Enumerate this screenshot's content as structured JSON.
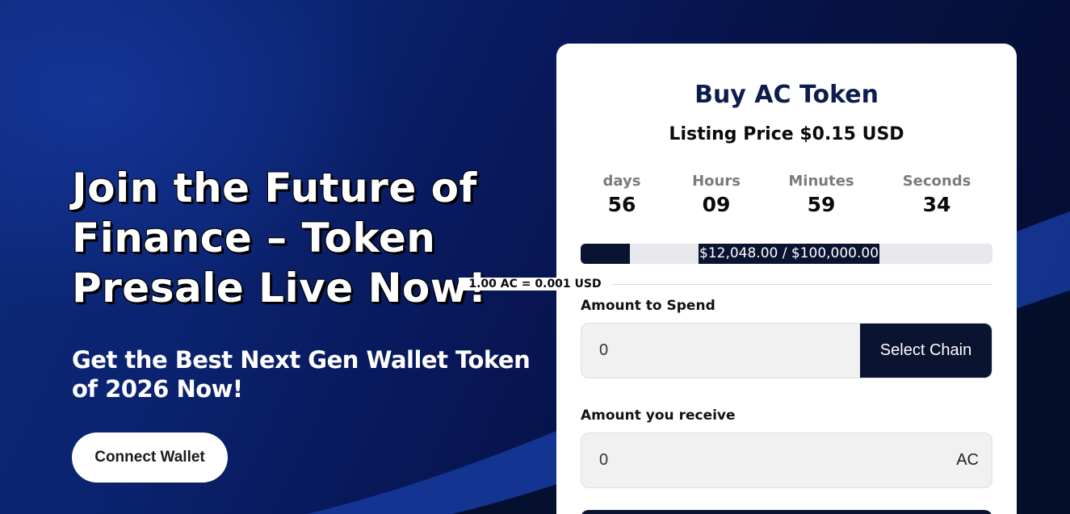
{
  "hero": {
    "title": "Join the Future of Finance – Token Presale Live Now!",
    "subtitle": "Get the Best Next Gen Wallet Token of 2026 Now!",
    "connect_label": "Connect Wallet"
  },
  "widget": {
    "title": "Buy AC Token",
    "listing_price": "Listing Price $0.15 USD",
    "countdown": [
      {
        "label": "days",
        "value": "56"
      },
      {
        "label": "Hours",
        "value": "09"
      },
      {
        "label": "Minutes",
        "value": "59"
      },
      {
        "label": "Seconds",
        "value": "34"
      }
    ],
    "raised_text": "$12,048.00 / $100,000.00",
    "raised_fraction": 0.12,
    "rate": "1.00 AC = 0.001 USD",
    "spend_label": "Amount to Spend",
    "spend_value": "0",
    "select_chain_label": "Select Chain",
    "receive_label": "Amount you receive",
    "receive_value": "0",
    "receive_unit": "AC"
  },
  "colors": {
    "accent_dark": "#0a1330",
    "title_navy": "#0c1d4d",
    "bg_blue": "#0b2370"
  }
}
